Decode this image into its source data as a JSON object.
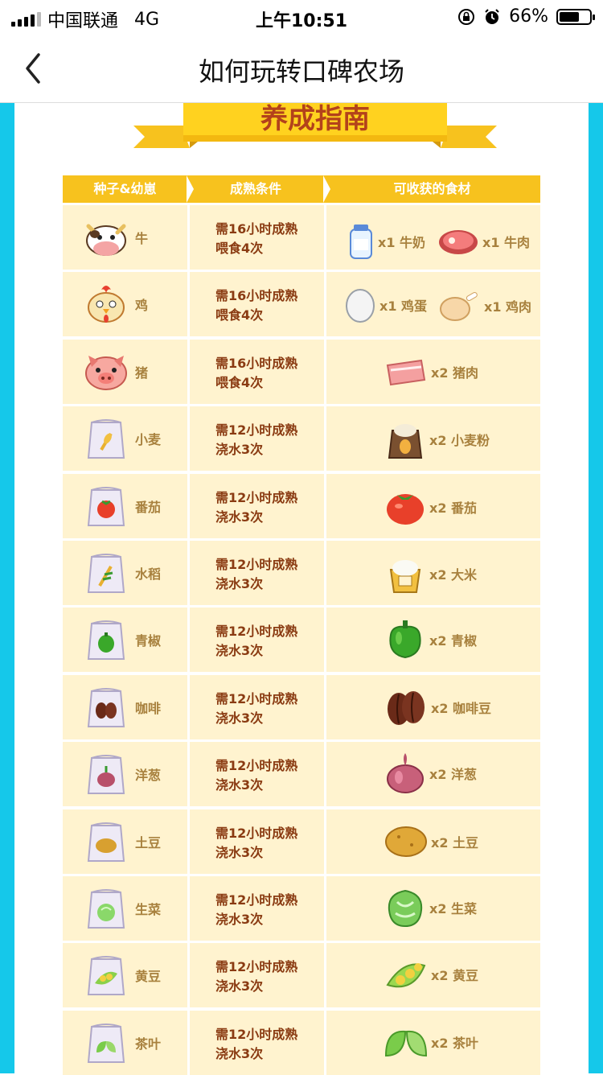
{
  "status": {
    "carrier": "中国联通",
    "network": "4G",
    "time": "上午10:51",
    "battery": "66%"
  },
  "nav": {
    "title": "如何玩转口碑农场"
  },
  "banner": {
    "title": "养成指南"
  },
  "table": {
    "headers": [
      "种子&幼崽",
      "成熟条件",
      "可收获的食材"
    ],
    "rows": [
      {
        "name": "牛",
        "cond1": "需16小时成熟",
        "cond2": "喂食4次",
        "p1": "x1 牛奶",
        "p2": "x1 牛肉"
      },
      {
        "name": "鸡",
        "cond1": "需16小时成熟",
        "cond2": "喂食4次",
        "p1": "x1 鸡蛋",
        "p2": "x1 鸡肉"
      },
      {
        "name": "猪",
        "cond1": "需16小时成熟",
        "cond2": "喂食4次",
        "p1": "x2 猪肉"
      },
      {
        "name": "小麦",
        "cond1": "需12小时成熟",
        "cond2": "浇水3次",
        "p1": "x2 小麦粉"
      },
      {
        "name": "番茄",
        "cond1": "需12小时成熟",
        "cond2": "浇水3次",
        "p1": "x2 番茄"
      },
      {
        "name": "水稻",
        "cond1": "需12小时成熟",
        "cond2": "浇水3次",
        "p1": "x2 大米"
      },
      {
        "name": "青椒",
        "cond1": "需12小时成熟",
        "cond2": "浇水3次",
        "p1": "x2 青椒"
      },
      {
        "name": "咖啡",
        "cond1": "需12小时成熟",
        "cond2": "浇水3次",
        "p1": "x2 咖啡豆"
      },
      {
        "name": "洋葱",
        "cond1": "需12小时成熟",
        "cond2": "浇水3次",
        "p1": "x2 洋葱"
      },
      {
        "name": "土豆",
        "cond1": "需12小时成熟",
        "cond2": "浇水3次",
        "p1": "x2 土豆"
      },
      {
        "name": "生菜",
        "cond1": "需12小时成熟",
        "cond2": "浇水3次",
        "p1": "x2 生菜"
      },
      {
        "name": "黄豆",
        "cond1": "需12小时成熟",
        "cond2": "浇水3次",
        "p1": "x2 黄豆"
      },
      {
        "name": "茶叶",
        "cond1": "需12小时成熟",
        "cond2": "浇水3次",
        "p1": "x2 茶叶"
      }
    ]
  },
  "colors": {
    "frame": "#15c8ea",
    "header": "#f7c21e",
    "cell": "#fff3cf",
    "titleText": "#b3421b"
  }
}
